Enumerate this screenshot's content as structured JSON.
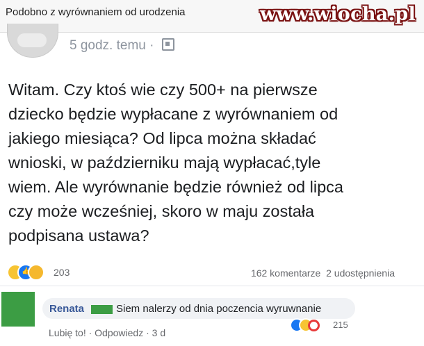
{
  "header": {
    "title": "Podobno z wyrównaniem od urodzenia",
    "watermark": "www.wiocha.pl"
  },
  "post": {
    "time": "5 godz. temu",
    "separator": "·",
    "audience_icon": "globe-icon",
    "text": "Witam. Czy ktoś wie czy 500+ na pierwsze\ndziecko będzie wypłacane z wyrównaniem od\njakiego miesiąca? Od lipca można składać\nwnioski, w październiku mają wypłacać,tyle\nwiem. Ale wyrównanie będzie również od lipca\nczy może wcześniej, skoro w maju została\npodpisana ustawa?",
    "reactions_count": "203",
    "comments": "162 komentarze",
    "shares": "2 udostępnienia"
  },
  "comment": {
    "author": "Renata",
    "text": "Siem nalerzy od dnia poczencia wyruwnanie",
    "like_label": "Lubię to!",
    "separator": "·",
    "reply_label": "Odpowiedz",
    "time": "3 d",
    "reactions_count": "215"
  },
  "colors": {
    "link": "#385898",
    "mask": "#3c9d44",
    "watermark_outline": "#7a1212"
  }
}
